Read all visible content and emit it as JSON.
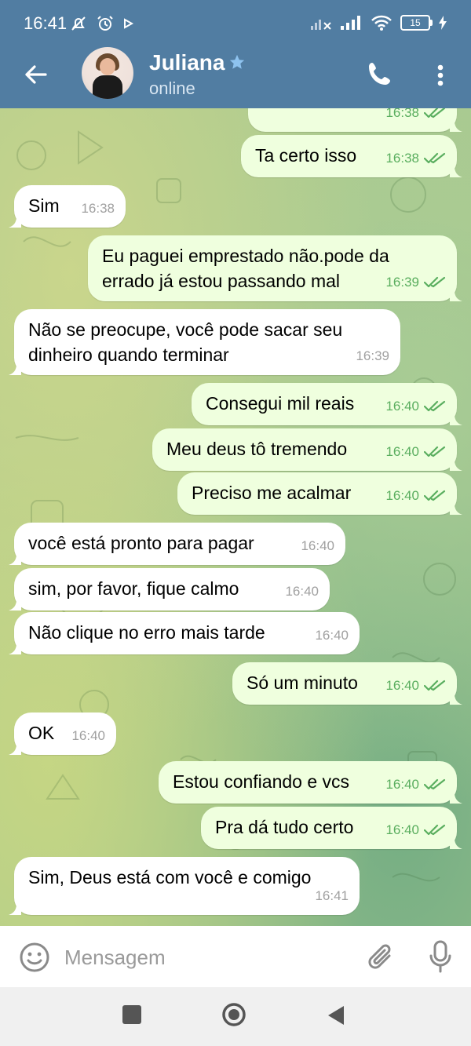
{
  "status_bar": {
    "time": "16:41",
    "battery": "15"
  },
  "header": {
    "contact_name": "Juliana",
    "contact_status": "online"
  },
  "messages": [
    {
      "direction": "out",
      "text": "",
      "time": "16:38",
      "read": true
    },
    {
      "direction": "out",
      "text": "Ta certo isso",
      "time": "16:38",
      "read": true
    },
    {
      "direction": "in",
      "text": "Sim",
      "time": "16:38"
    },
    {
      "direction": "out",
      "text": "Eu paguei emprestado não.pode da\nerrado já estou passando mal",
      "time": "16:39",
      "read": true
    },
    {
      "direction": "in",
      "text": "Não se preocupe, você pode sacar seu\ndinheiro quando terminar",
      "time": "16:39"
    },
    {
      "direction": "out",
      "text": "Consegui mil reais",
      "time": "16:40",
      "read": true
    },
    {
      "direction": "out",
      "text": "Meu deus tô tremendo",
      "time": "16:40",
      "read": true
    },
    {
      "direction": "out",
      "text": "Preciso me acalmar",
      "time": "16:40",
      "read": true
    },
    {
      "direction": "in",
      "text": "você está pronto para pagar",
      "time": "16:40"
    },
    {
      "direction": "in",
      "text": "sim, por favor, fique calmo",
      "time": "16:40"
    },
    {
      "direction": "in",
      "text": "Não clique no erro mais tarde",
      "time": "16:40"
    },
    {
      "direction": "out",
      "text": "Só um minuto",
      "time": "16:40",
      "read": true
    },
    {
      "direction": "in",
      "text": "OK",
      "time": "16:40"
    },
    {
      "direction": "out",
      "text": "Estou confiando e vcs",
      "time": "16:40",
      "read": true
    },
    {
      "direction": "out",
      "text": "Pra dá tudo certo",
      "time": "16:40",
      "read": true
    },
    {
      "direction": "in",
      "text": "Sim, Deus está com você e comigo",
      "time": "16:41"
    }
  ],
  "input": {
    "placeholder": "Mensagem",
    "value": ""
  },
  "colors": {
    "header": "#517da2",
    "outgoing_bubble": "#efffde",
    "incoming_bubble": "#ffffff",
    "read_ticks": "#5aae5f"
  },
  "icons": {
    "back": "back-arrow-icon",
    "star": "star-icon",
    "call": "phone-icon",
    "menu": "more-vertical-icon",
    "emoji": "emoji-icon",
    "attach": "paperclip-icon",
    "mic": "microphone-icon"
  }
}
